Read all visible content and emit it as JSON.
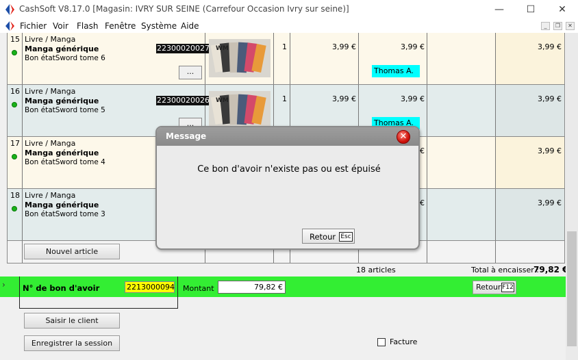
{
  "window": {
    "title": "CashSoft V8.17.0 [Magasin: IVRY SUR SEINE (Carrefour Occasion Ivry sur seine)]",
    "minimize": "—",
    "maximize": "☐",
    "close": "✕"
  },
  "menu": {
    "items": [
      "Fichier",
      "Voir",
      "Flash",
      "Fenêtre",
      "Système",
      "Aide"
    ],
    "mdi": [
      "_",
      "❐",
      "✕"
    ]
  },
  "rows": [
    {
      "index": "15",
      "category": "Livre / Manga",
      "name": "Manga générique",
      "subtitle": "Bon étatSword tome 6",
      "code": "22300020027",
      "more": "...",
      "qty": "1",
      "price": "3,99 €",
      "price2": "3,99 €",
      "seller": "Thomas A.",
      "total": "3,99 €"
    },
    {
      "index": "16",
      "category": "Livre / Manga",
      "name": "Manga générique",
      "subtitle": "Bon étatSword tome 5",
      "code": "22300020026",
      "more": "...",
      "qty": "1",
      "price": "3,99 €",
      "price2": "3,99 €",
      "seller": "Thomas A.",
      "total": "3,99 €"
    },
    {
      "index": "17",
      "category": "Livre / Manga",
      "name": "Manga générique",
      "subtitle": "Bon étatSword tome 4",
      "code": "",
      "more": "",
      "qty": "",
      "price": "",
      "price2": "€",
      "seller": "",
      "total": "3,99 €"
    },
    {
      "index": "18",
      "category": "Livre / Manga",
      "name": "Manga générique",
      "subtitle": "Bon étatSword tome 3",
      "code": "",
      "more": "",
      "qty": "",
      "price": "",
      "price2": "€",
      "seller": "",
      "total": "3,99 €"
    }
  ],
  "grid": {
    "new_article": "Nouvel article"
  },
  "summary": {
    "count": "18 articles",
    "total_label": "Total à encaisser :",
    "total_value": "79,82 €"
  },
  "voucher": {
    "arrow": "›",
    "label": "N° de bon d'avoir",
    "number": "2213000094",
    "amount_label": "Montant",
    "amount": "79,82 €",
    "back": "Retour",
    "back_key": "F12"
  },
  "actions": {
    "client": "Saisir le client",
    "session": "Enregistrer la session",
    "invoice": "Facture"
  },
  "dialog": {
    "title": "Message",
    "close": "✕",
    "message": "Ce bon d'avoir n'existe pas ou est épuisé",
    "button": "Retour",
    "button_key": "Esc"
  },
  "colors": {
    "green_bar": "#33ee33",
    "seller_badge": "#00ffff",
    "voucher_field": "#ffff00",
    "row_alt": "#e3ecec",
    "row_main": "#fdf8ea"
  }
}
